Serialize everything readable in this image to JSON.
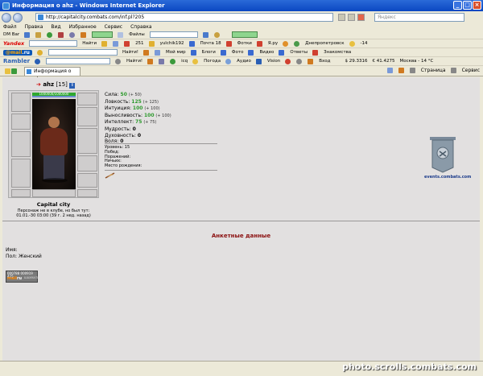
{
  "window": {
    "title": "Информация о ahz - Windows Internet Explorer"
  },
  "address": {
    "url": "http://capitalcity.combats.com/inf.pl?205",
    "search_placeholder": "Яндекс"
  },
  "menu": [
    "Файл",
    "Правка",
    "Вид",
    "Избранное",
    "Сервис",
    "Справка"
  ],
  "toolbar1": {
    "label": "DM Bar",
    "files_label": "Файлы"
  },
  "toolbar2": {
    "brand": "Yandex",
    "find": "Найти",
    "count": "251",
    "user": "yulchik192",
    "mail": "Почта 18",
    "photos": "Фотки",
    "yaru": "Я.ру",
    "city": "Днепропетровск",
    "temp": "-14"
  },
  "toolbar3": {
    "brand_a": "@mail",
    "brand_b": ".ru",
    "find": "Найти!",
    "my_world": "Мой мир",
    "blogs": "Блоги",
    "photo": "Фото",
    "video": "Видео",
    "answers": "Ответы",
    "dating": "Знакомства"
  },
  "toolbar4": {
    "brand": "Rambler",
    "find": "Найти!",
    "icq": "icq",
    "weather": "Погода",
    "audio": "Аудио",
    "vision": "Vision",
    "login": "Вход",
    "usd": "$ 29.3316",
    "eur": "€ 41.4275",
    "city": "Москва - 14 °C"
  },
  "tab": {
    "label": "Информация о ahz"
  },
  "commands": {
    "page": "Страница",
    "service": "Сервис"
  },
  "character": {
    "name": "ahz",
    "level": "[15]",
    "hp": "1000000/1000000",
    "city": "Capital city",
    "presence_line1": "Персонаж не в клубе, но был тут:",
    "presence_line2": "01.01.-30 03:00 (39 г. 2 нед. назад)"
  },
  "stats": [
    {
      "label": "Сила:",
      "value": "50",
      "bonus": "(+ 50)"
    },
    {
      "label": "Ловкость:",
      "value": "125",
      "bonus": "(+ 125)"
    },
    {
      "label": "Интуиция:",
      "value": "100",
      "bonus": "(+ 100)"
    },
    {
      "label": "Выносливость:",
      "value": "100",
      "bonus": "(+ 100)"
    },
    {
      "label": "Интеллект:",
      "value": "75",
      "bonus": "(+ 75)"
    },
    {
      "label": "Мудрость:",
      "value": "0",
      "bonus": ""
    },
    {
      "label": "Духовность:",
      "value": "0",
      "bonus": ""
    },
    {
      "label": "Воля:",
      "value": "0",
      "bonus": ""
    }
  ],
  "extra": [
    "Уровень: 15",
    "Побед:",
    "Поражений:",
    "Ничьих:",
    "Место рождения:"
  ],
  "banner_link": "events.combats.com",
  "anketa_title": "Анкетные данные",
  "info": {
    "name": "Имя:",
    "gender": "Пол: Женский"
  },
  "counter": {
    "top": "000788 000919 425",
    "brand_a": "mail",
    "brand_b": "ru",
    "side": "ШАХМАТИ"
  },
  "watermark": "photo.scrolls.combats.com",
  "colors": {
    "stat_value": "#2e9a2e",
    "heading": "#8b1010",
    "titlebar": "#0b47c2"
  }
}
